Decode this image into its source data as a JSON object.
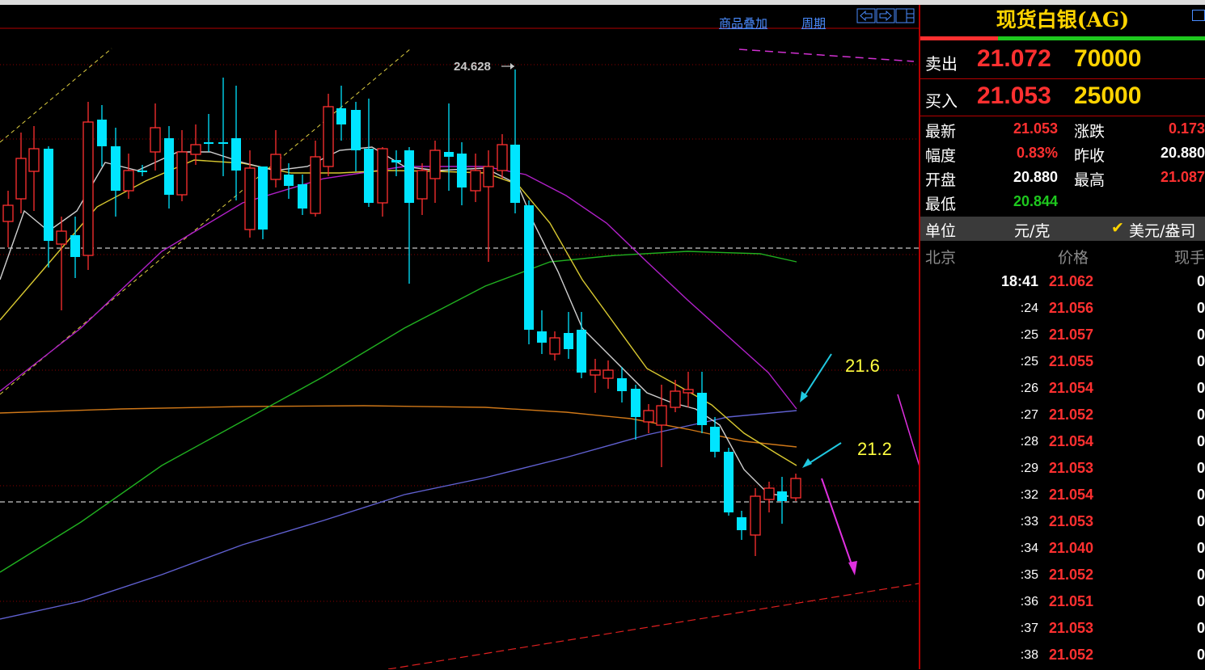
{
  "toolbar": {
    "overlay_label": "商品叠加",
    "period_label": "周期"
  },
  "chart": {
    "peak_label": "24.628",
    "annotation_upper": "21.6",
    "annotation_lower": "21.2"
  },
  "colors": {
    "up": "#ff3030",
    "down": "#00e5ff",
    "ma_white": "#d0d0d0",
    "ma_yellow": "#d8c830",
    "ma_magenta": "#b020c8",
    "ma_green": "#20b020",
    "ma_orange": "#d07818",
    "ma_blue": "#6060d0",
    "annotation_text": "#ffff40",
    "arrow_cyan": "#20c8e0",
    "arrow_magenta": "#e030e0"
  },
  "panel": {
    "title": "现货白银(AG)",
    "sell": {
      "label": "卖出",
      "price": "21.072",
      "volume": "70000"
    },
    "buy": {
      "label": "买入",
      "price": "21.053",
      "volume": "25000"
    },
    "stats": {
      "latest_label": "最新",
      "latest": "21.053",
      "change_label": "涨跌",
      "change": "0.173",
      "amplitude_label": "幅度",
      "amplitude": "0.83%",
      "prev_close_label": "昨收",
      "prev_close": "20.880",
      "open_label": "开盘",
      "open": "20.880",
      "high_label": "最高",
      "high": "21.087",
      "low_label": "最低",
      "low": "20.844"
    },
    "unit_label": "单位",
    "unit_cny": "元/克",
    "unit_usd": "美元/盎司",
    "ticks_header": {
      "time": "北京",
      "price": "价格",
      "volume": "现手"
    },
    "ticks": [
      {
        "time": "18:41",
        "price": "21.062",
        "volume": "0"
      },
      {
        "time": ":24",
        "price": "21.056",
        "volume": "0"
      },
      {
        "time": ":25",
        "price": "21.057",
        "volume": "0"
      },
      {
        "time": ":25",
        "price": "21.055",
        "volume": "0"
      },
      {
        "time": ":26",
        "price": "21.054",
        "volume": "0"
      },
      {
        "time": ":27",
        "price": "21.052",
        "volume": "0"
      },
      {
        "time": ":28",
        "price": "21.054",
        "volume": "0"
      },
      {
        "time": ":29",
        "price": "21.053",
        "volume": "0"
      },
      {
        "time": ":32",
        "price": "21.054",
        "volume": "0"
      },
      {
        "time": ":33",
        "price": "21.053",
        "volume": "0"
      },
      {
        "time": ":34",
        "price": "21.040",
        "volume": "0"
      },
      {
        "time": ":35",
        "price": "21.052",
        "volume": "0"
      },
      {
        "time": ":36",
        "price": "21.051",
        "volume": "0"
      },
      {
        "time": ":37",
        "price": "21.053",
        "volume": "0"
      },
      {
        "time": ":38",
        "price": "21.052",
        "volume": "0"
      }
    ]
  }
}
